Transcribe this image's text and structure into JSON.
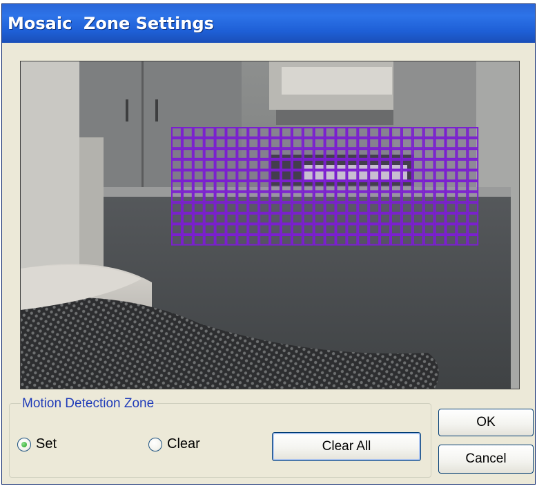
{
  "window": {
    "title": "Mosaic  Zone Settings"
  },
  "preview": {
    "grid_color": "#7B1FD0",
    "grid_rows": 11,
    "grid_cols": 28
  },
  "zone_group": {
    "legend": "Motion Detection Zone",
    "set_label": "Set",
    "clear_label": "Clear",
    "selected": "Set",
    "clear_all_label": "Clear All"
  },
  "buttons": {
    "ok_label": "OK",
    "cancel_label": "Cancel"
  },
  "colors": {
    "titlebar": "#245EDC",
    "dialog_bg": "#ECE9D8",
    "legend_text": "#1F3BB8"
  }
}
